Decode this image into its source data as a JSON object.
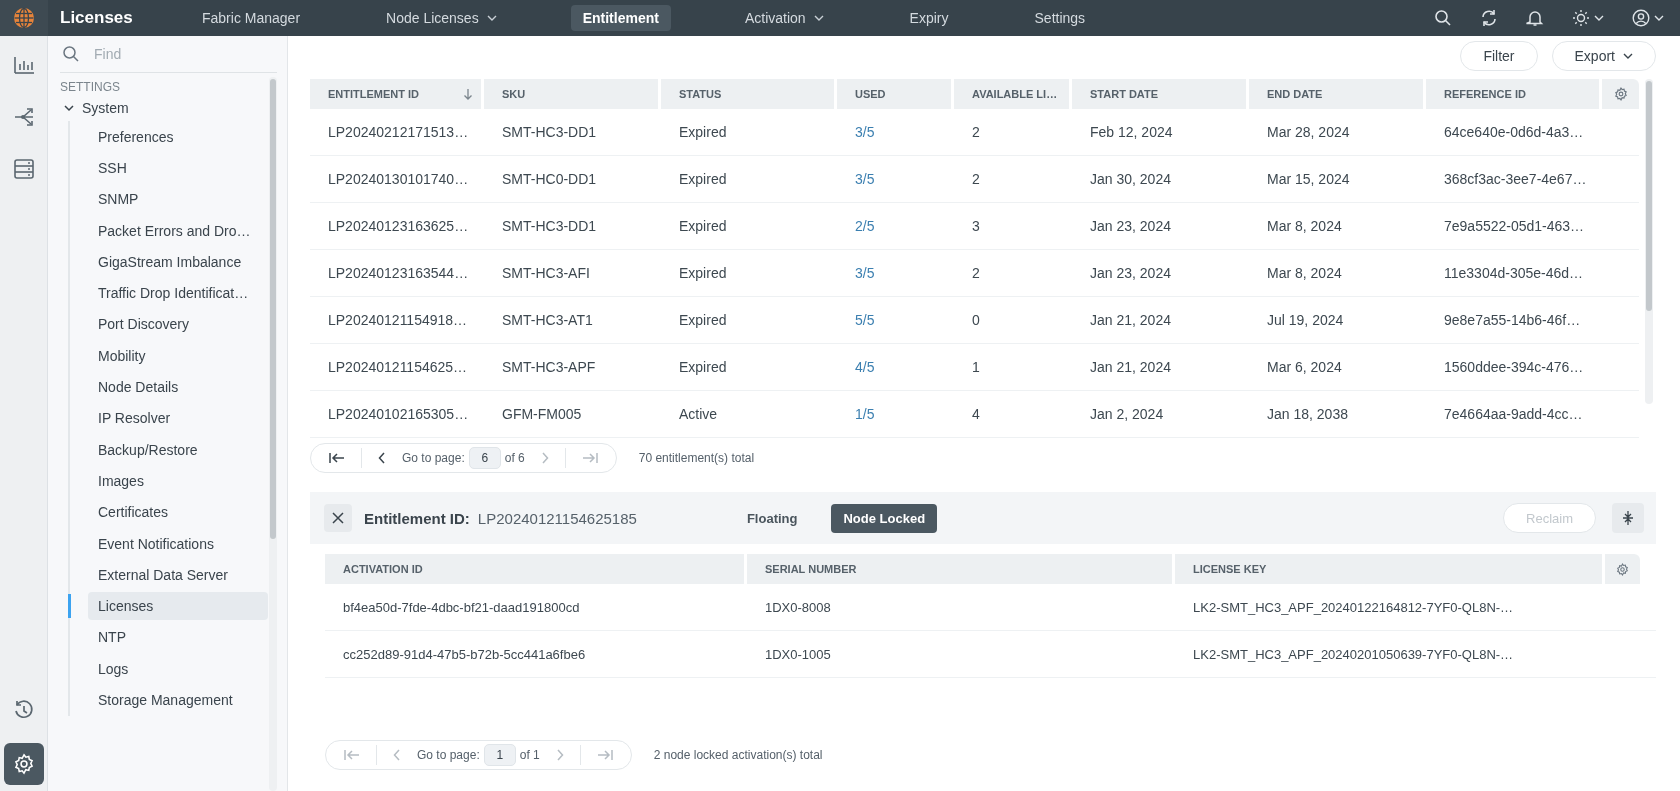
{
  "topbar": {
    "app_title": "Licenses",
    "nav": [
      {
        "label": "Fabric Manager",
        "selected": false,
        "dropdown": false
      },
      {
        "label": "Node Licenses",
        "selected": false,
        "dropdown": true
      },
      {
        "label": "Entitlement",
        "selected": true,
        "dropdown": false
      },
      {
        "label": "Activation",
        "selected": false,
        "dropdown": true
      },
      {
        "label": "Expiry",
        "selected": false,
        "dropdown": false
      },
      {
        "label": "Settings",
        "selected": false,
        "dropdown": false
      }
    ],
    "actions": [
      {
        "kind": "search",
        "dropdown": false
      },
      {
        "kind": "refresh",
        "dropdown": false
      },
      {
        "kind": "bell",
        "dropdown": false
      },
      {
        "kind": "sun",
        "dropdown": true
      },
      {
        "kind": "user",
        "dropdown": true
      }
    ]
  },
  "rail": {
    "items": [
      {
        "kind": "chart",
        "selected": false
      },
      {
        "kind": "network",
        "selected": false
      },
      {
        "kind": "server",
        "selected": false
      }
    ],
    "bottom_items": [
      {
        "kind": "history",
        "selected": false
      },
      {
        "kind": "settings",
        "selected": true
      }
    ]
  },
  "sidebar": {
    "search": {
      "placeholder": "Find"
    },
    "section": "SETTINGS",
    "group": {
      "label": "System",
      "expanded": true,
      "children": [
        {
          "label": "Preferences",
          "selected": false
        },
        {
          "label": "SSH",
          "selected": false
        },
        {
          "label": "SNMP",
          "selected": false
        },
        {
          "label": "Packet Errors and Dro…",
          "selected": false
        },
        {
          "label": "GigaStream Imbalance",
          "selected": false
        },
        {
          "label": "Traffic Drop Identificat…",
          "selected": false
        },
        {
          "label": "Port Discovery",
          "selected": false
        },
        {
          "label": "Mobility",
          "selected": false
        },
        {
          "label": "Node Details",
          "selected": false
        },
        {
          "label": "IP Resolver",
          "selected": false
        },
        {
          "label": "Backup/Restore",
          "selected": false
        },
        {
          "label": "Images",
          "selected": false
        },
        {
          "label": "Certificates",
          "selected": false
        },
        {
          "label": "Event Notifications",
          "selected": false
        },
        {
          "label": "External Data Server",
          "selected": false
        },
        {
          "label": "Licenses",
          "selected": true
        },
        {
          "label": "NTP",
          "selected": false
        },
        {
          "label": "Logs",
          "selected": false
        },
        {
          "label": "Storage Management",
          "selected": false
        }
      ]
    }
  },
  "toolbar": {
    "buttons": [
      {
        "label": "Filter",
        "dropdown": false
      },
      {
        "label": "Export",
        "dropdown": true
      }
    ]
  },
  "table": {
    "columns": [
      {
        "label": "ENTITLEMENT ID",
        "kind": "text",
        "sorted": true
      },
      {
        "label": "SKU",
        "kind": "text",
        "sorted": false
      },
      {
        "label": "STATUS",
        "kind": "text",
        "sorted": false
      },
      {
        "label": "USED",
        "kind": "link",
        "sorted": false
      },
      {
        "label": "AVAILABLE LI…",
        "kind": "text",
        "sorted": false
      },
      {
        "label": "START DATE",
        "kind": "text",
        "sorted": false
      },
      {
        "label": "END DATE",
        "kind": "text",
        "sorted": false
      },
      {
        "label": "REFERENCE ID",
        "kind": "text",
        "sorted": false
      }
    ],
    "rows": [
      [
        "LP20240212171513…",
        "SMT-HC3-DD1",
        "Expired",
        "3/5",
        "2",
        "Feb 12, 2024",
        "Mar 28, 2024",
        "64ce640e-0d6d-4a3…"
      ],
      [
        "LP20240130101740…",
        "SMT-HC0-DD1",
        "Expired",
        "3/5",
        "2",
        "Jan 30, 2024",
        "Mar 15, 2024",
        "368cf3ac-3ee7-4e67…"
      ],
      [
        "LP20240123163625…",
        "SMT-HC3-DD1",
        "Expired",
        "2/5",
        "3",
        "Jan 23, 2024",
        "Mar 8, 2024",
        "7e9a5522-05d1-463…"
      ],
      [
        "LP20240123163544…",
        "SMT-HC3-AFI",
        "Expired",
        "3/5",
        "2",
        "Jan 23, 2024",
        "Mar 8, 2024",
        "11e3304d-305e-46d…"
      ],
      [
        "LP20240121154918…",
        "SMT-HC3-AT1",
        "Expired",
        "5/5",
        "0",
        "Jan 21, 2024",
        "Jul 19, 2024",
        "9e8e7a55-14b6-46f…"
      ],
      [
        "LP20240121154625…",
        "SMT-HC3-APF",
        "Expired",
        "4/5",
        "1",
        "Jan 21, 2024",
        "Mar 6, 2024",
        "1560ddee-394c-476…"
      ],
      [
        "LP20240102165305…",
        "GFM-FM005",
        "Active",
        "1/5",
        "4",
        "Jan 2, 2024",
        "Jan 18, 2038",
        "7e4664aa-9add-4cc…"
      ]
    ],
    "pagination": {
      "label": "Go to page:",
      "page": "6",
      "of": "of 6",
      "first_disabled": false,
      "prev_disabled": false,
      "next_disabled": true,
      "last_disabled": true
    },
    "total": "70 entitlement(s) total"
  },
  "detail": {
    "label": "Entitlement ID:",
    "value": "LP20240121154625185",
    "modes": [
      {
        "label": "Floating",
        "selected": false
      },
      {
        "label": "Node Locked",
        "selected": true
      }
    ],
    "reclaim": {
      "label": "Reclaim",
      "disabled": true
    },
    "table": {
      "columns": [
        {
          "label": "ACTIVATION ID"
        },
        {
          "label": "SERIAL NUMBER"
        },
        {
          "label": "LICENSE KEY"
        }
      ],
      "rows": [
        [
          "bf4ea50d-7fde-4dbc-bf21-daad191800cd",
          "1DX0-8008",
          "LK2-SMT_HC3_APF_20240122164812-7YF0-QL8N-…"
        ],
        [
          "cc252d89-91d4-47b5-b72b-5cc441a6fbe6",
          "1DX0-1005",
          "LK2-SMT_HC3_APF_20240201050639-7YF0-QL8N-…"
        ]
      ]
    },
    "pagination": {
      "label": "Go to page:",
      "page": "1",
      "of": "of 1",
      "first_disabled": true,
      "prev_disabled": true,
      "next_disabled": true,
      "last_disabled": true
    },
    "total": "2 node locked activation(s) total"
  }
}
